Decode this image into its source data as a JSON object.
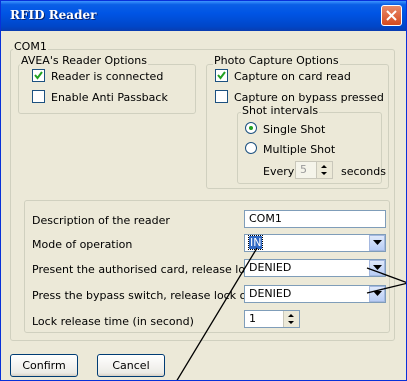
{
  "window": {
    "title": "RFID Reader"
  },
  "main_group_label": "COM1",
  "avea": {
    "legend": "AVEA's Reader Options",
    "reader_connected": {
      "label": "Reader is connected",
      "checked": true
    },
    "anti_passback": {
      "label": "Enable Anti Passback",
      "checked": false
    }
  },
  "photo": {
    "legend": "Photo Capture Options",
    "capture_card": {
      "label": "Capture on card read",
      "checked": true
    },
    "capture_bypass": {
      "label": "Capture on bypass pressed",
      "checked": false
    },
    "shot_intervals": {
      "legend": "Shot intervals",
      "single": {
        "label": "Single Shot",
        "selected": true
      },
      "multiple": {
        "label": "Multiple Shot",
        "selected": false
      },
      "every_label": "Every",
      "every_value": "5",
      "seconds_label": "seconds"
    }
  },
  "settings": {
    "description": {
      "label": "Description of the reader",
      "value": "COM1"
    },
    "mode": {
      "label": "Mode of operation",
      "value": "IN"
    },
    "card_release": {
      "label": "Present the authorised card, release lock on",
      "value": "DENIED"
    },
    "bypass_release": {
      "label": "Press the bypass switch, release lock on",
      "value": "DENIED"
    },
    "lock_time": {
      "label": "Lock release time (in second)",
      "value": "1"
    }
  },
  "buttons": {
    "confirm": "Confirm",
    "cancel": "Cancel"
  }
}
